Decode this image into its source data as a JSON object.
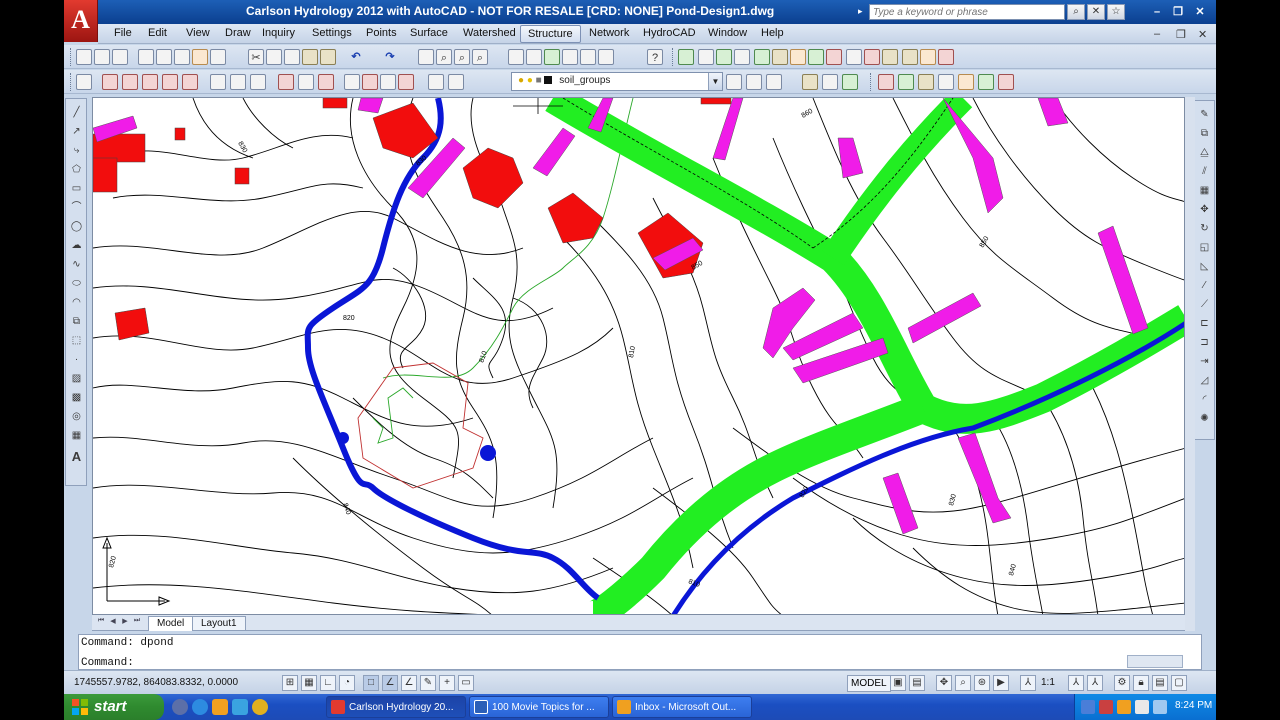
{
  "window": {
    "title": "Carlson Hydrology 2012 with AutoCAD - NOT FOR RESALE [CRD: NONE] ",
    "file": "Pond-Design1.dwg",
    "logo_letter": "A",
    "search_placeholder": "Type a keyword or phrase"
  },
  "menu": {
    "items": [
      "File",
      "Edit",
      "View",
      "Draw",
      "Inquiry",
      "Settings",
      "Points",
      "Surface",
      "Watershed",
      "Structure",
      "Network",
      "HydroCAD",
      "Window",
      "Help"
    ],
    "active": "Structure"
  },
  "layer": {
    "name": "soil_groups"
  },
  "tabs": {
    "model": "Model",
    "layout1": "Layout1"
  },
  "command": {
    "history": "Command: dpond",
    "prompt": "Command:"
  },
  "status": {
    "coordinates": "1745557.9782, 864083.8332, 0.0000",
    "model_label": "MODEL",
    "scale": "1:1"
  },
  "taskbar": {
    "start": "start",
    "tasks": [
      "Carlson Hydrology 20...",
      "100 Movie Topics for ...",
      "Inbox - Microsoft Out..."
    ],
    "clock": "8:24 PM"
  },
  "drawing": {
    "contour_labels": [
      "830",
      "820",
      "810",
      "840",
      "830",
      "820",
      "810",
      "850",
      "860",
      "850",
      "840",
      "830",
      "820",
      "810"
    ],
    "colors": {
      "road": "#22ee22",
      "watershed": "#0a16d6",
      "building": "#f20d0d",
      "driveway": "#f01ce8",
      "contour": "#000000"
    }
  }
}
